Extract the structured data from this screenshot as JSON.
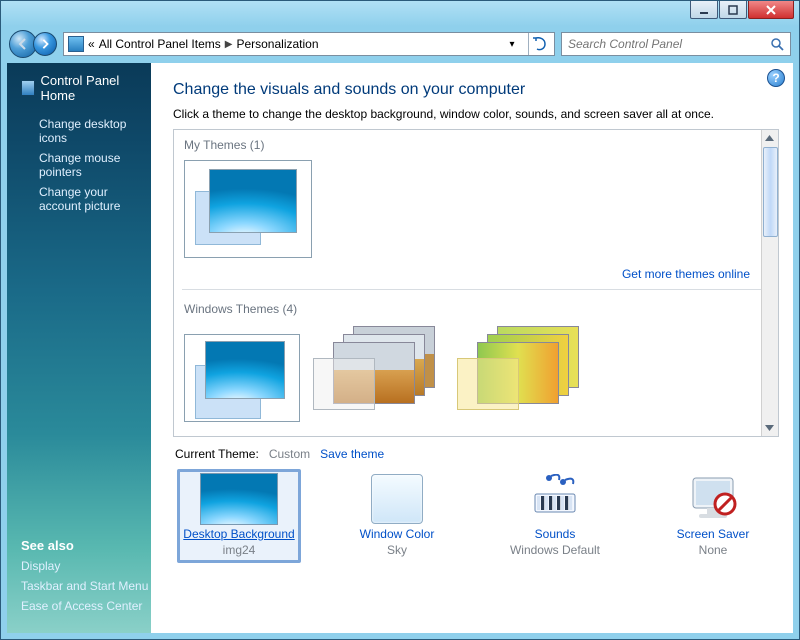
{
  "breadcrumb": {
    "prefix": "«",
    "level1": "All Control Panel Items",
    "level2": "Personalization"
  },
  "search": {
    "placeholder": "Search Control Panel"
  },
  "sidebar": {
    "home": "Control Panel Home",
    "links": [
      {
        "label": "Change desktop icons"
      },
      {
        "label": "Change mouse pointers"
      },
      {
        "label": "Change your account picture"
      }
    ],
    "see_also_header": "See also",
    "see_also": [
      {
        "label": "Display"
      },
      {
        "label": "Taskbar and Start Menu"
      },
      {
        "label": "Ease of Access Center"
      }
    ]
  },
  "main": {
    "title": "Change the visuals and sounds on your computer",
    "subtitle": "Click a theme to change the desktop background, window color, sounds, and screen saver all at once.",
    "my_themes_label": "My Themes (1)",
    "get_more": "Get more themes online",
    "windows_themes_label": "Windows Themes (4)",
    "current_theme_label": "Current Theme:",
    "current_theme_value": "Custom",
    "save_theme": "Save theme"
  },
  "components": {
    "bg": {
      "name": "Desktop Background",
      "value": "img24"
    },
    "color": {
      "name": "Window Color",
      "value": "Sky"
    },
    "sound": {
      "name": "Sounds",
      "value": "Windows Default"
    },
    "saver": {
      "name": "Screen Saver",
      "value": "None"
    }
  }
}
